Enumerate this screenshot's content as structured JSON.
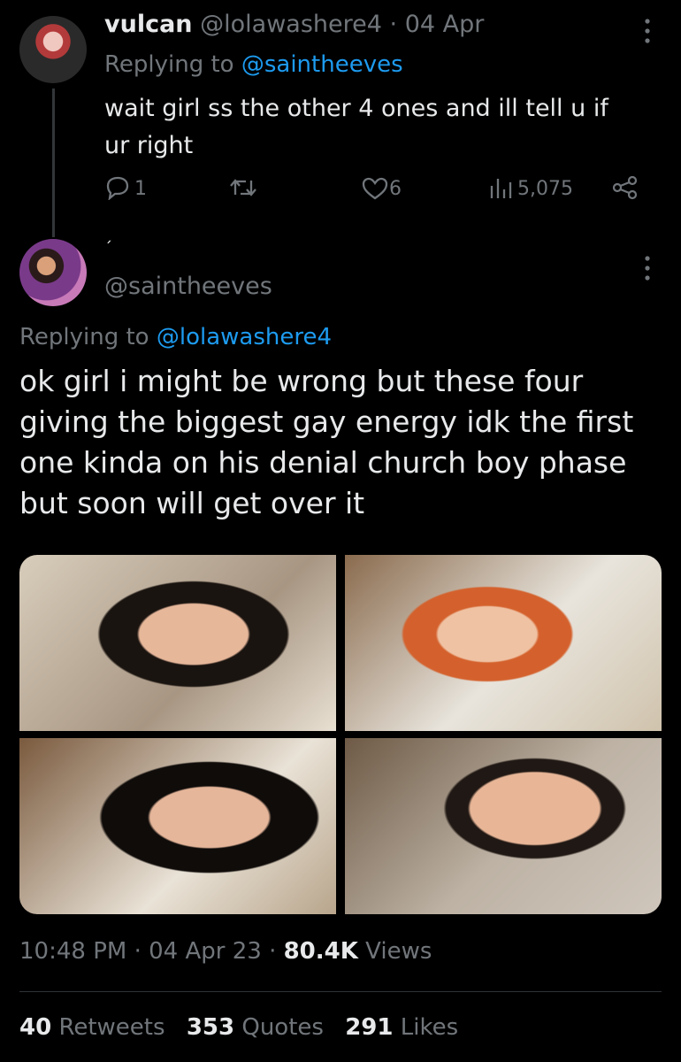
{
  "reply1": {
    "display_name": "vulcan",
    "handle": "@lolawashere4",
    "separator": "·",
    "date": "04 Apr",
    "replying_prefix": "Replying to",
    "replying_to": "@saintheeves",
    "text": "wait girl ss the other 4 ones and ill tell u if ur right",
    "replies": "1",
    "likes": "6",
    "views": "5,075"
  },
  "main_tweet": {
    "display_name": "´",
    "handle": "@saintheeves",
    "replying_prefix": "Replying to",
    "replying_to": "@lolawashere4",
    "text": "ok girl i might be wrong but these four giving the biggest gay energy idk the first one kinda on his denial church boy phase but soon will get over it",
    "time": "10:48 PM",
    "separator": "·",
    "date": "04 Apr 23",
    "views_count": "80.4K",
    "views_label": "Views",
    "retweets_count": "40",
    "retweets_label": "Retweets",
    "quotes_count": "353",
    "quotes_label": "Quotes",
    "likes_count": "291",
    "likes_label": "Likes"
  },
  "icons": [
    "more-icon",
    "reply-icon",
    "retweet-icon",
    "like-icon",
    "views-icon",
    "share-icon"
  ],
  "colors": {
    "background": "#000000",
    "text": "#e7e9ea",
    "muted": "#71767b",
    "link": "#1d9bf0"
  }
}
